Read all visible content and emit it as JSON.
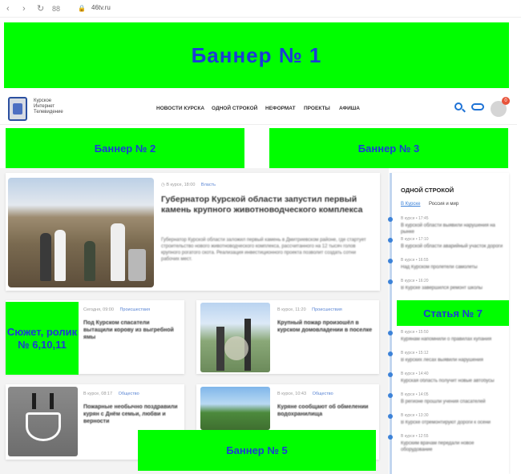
{
  "browser": {
    "url": "46tv.ru"
  },
  "banners": {
    "b1": "Баннер № 1",
    "b2": "Баннер № 2",
    "b3": "Баннер № 3",
    "b4": "Сюжет, ролик № 6,10,11",
    "b5": "Баннер № 5",
    "b7": "Статья № 7"
  },
  "header": {
    "logo_lines": [
      "Курское",
      "Интернет",
      "Телевидение"
    ],
    "menu": [
      "НОВОСТИ КУРСКА",
      "ОДНОЙ СТРОКОЙ",
      "НЕФОРМАТ",
      "ПРОЕКТЫ",
      "АФИША"
    ],
    "badge_count": "0"
  },
  "featured": {
    "meta_date": "В курсе, 18:00",
    "meta_cat": "Власть",
    "title": "Губернатор Курской области запустил первый камень крупного животноводческого комплекса",
    "excerpt": "Губернатор Курской области заложил первый камень в Дмитриевском районе, где стартует строительство нового животноводческого комплекса, рассчитанного на 12 тысяч голов крупного рогатого скота. Реализация инвестиционного проекта позволит создать сотни рабочих мест."
  },
  "cards": [
    {
      "meta_date": "Сегодня, 09:00",
      "meta_cat": "Происшествия",
      "title": "Под Курском спасатели вытащили корову из выгребной ямы"
    },
    {
      "meta_date": "В курсе, 11:20",
      "meta_cat": "Происшествия",
      "title": "Крупный пожар произошёл в курском домовладении в поселке"
    },
    {
      "meta_date": "В курсе, 08:17",
      "meta_cat": "Общество",
      "title": "Пожарные необычно поздравили курян с Днём семьи, любви и верности"
    },
    {
      "meta_date": "В курсе, 10:43",
      "meta_cat": "Общество",
      "title": "Куряне сообщают об обмелении водохранилища"
    }
  ],
  "sidebar": {
    "title": "ОДНОЙ СТРОКОЙ",
    "tabs": [
      "В Курске",
      "Россия и мир"
    ],
    "items": [
      {
        "meta": "В курсе  •  17:45",
        "text": "В курской области выявили нарушения на рынке"
      },
      {
        "meta": "В курсе  •  17:10",
        "text": "В курской области аварийный участок дороги"
      },
      {
        "meta": "В курсе  •  16:55",
        "text": "Над Курском пролетели самолеты"
      },
      {
        "meta": "В курсе  •  16:20",
        "text": "В Курске завершился ремонт школы"
      },
      {
        "meta": "В курсе  •  15:50",
        "text": "Курянам напомнили о правилах купания"
      },
      {
        "meta": "В курсе  •  15:12",
        "text": "В курских лесах выявили нарушения"
      },
      {
        "meta": "В курсе  •  14:40",
        "text": "Курская область получит новые автобусы"
      },
      {
        "meta": "В курсе  •  14:05",
        "text": "В регионе прошли учения спасателей"
      },
      {
        "meta": "В курсе  •  13:30",
        "text": "В Курске отремонтируют дороги к осени"
      },
      {
        "meta": "В курсе  •  12:55",
        "text": "Курским врачам передали новое оборудование"
      }
    ]
  }
}
